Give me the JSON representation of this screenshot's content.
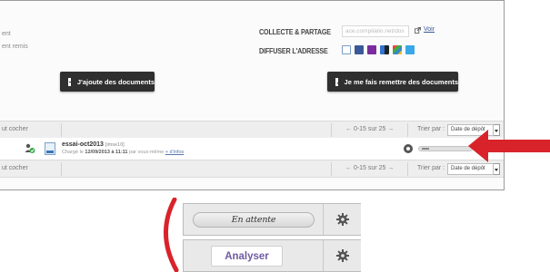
{
  "panel": {
    "cut_texts": [
      "ent",
      "ent remis"
    ],
    "collecte_label": "COLLECTE & PARTAGE",
    "collecte_input": "ace.compilatio.net/dos",
    "voir_link": "Voir",
    "diffuser_label": "DIFFUSER L'ADRESSE",
    "social_icons": [
      "mail-icon",
      "facebook-icon",
      "yahoo-icon",
      "delicious-icon",
      "windows-live-icon",
      "twitter-icon"
    ],
    "add_button": "J'ajoute des documents",
    "remit_button": "Je me fais remettre des documents"
  },
  "toolbar_top": {
    "check_all": "ut cocher",
    "pagination": "←  0-15 sur 25  →",
    "sort_label": "Trier par :",
    "sort_value": "Date de dépôt"
  },
  "document": {
    "title": "essai-oct2013",
    "meta": "[imse10]",
    "uploaded_prefix": "Chargé le",
    "uploaded_date": "12/09/2013 à 11:11",
    "uploaded_suffix": "par vous-même",
    "more_link": "+ d'infos"
  },
  "toolbar_bottom": {
    "check_all": "ut cocher",
    "pagination": "←  0-15 sur 25  →",
    "sort_label": "Trier par :",
    "sort_value": "Date de dépôt"
  },
  "zoom": {
    "waiting_status": "En attente",
    "analyse_button": "Analyser"
  },
  "colors": {
    "accent_red": "#d9232a",
    "analyse_text": "#6f5aa2",
    "button_dark": "#2f2f2f"
  }
}
